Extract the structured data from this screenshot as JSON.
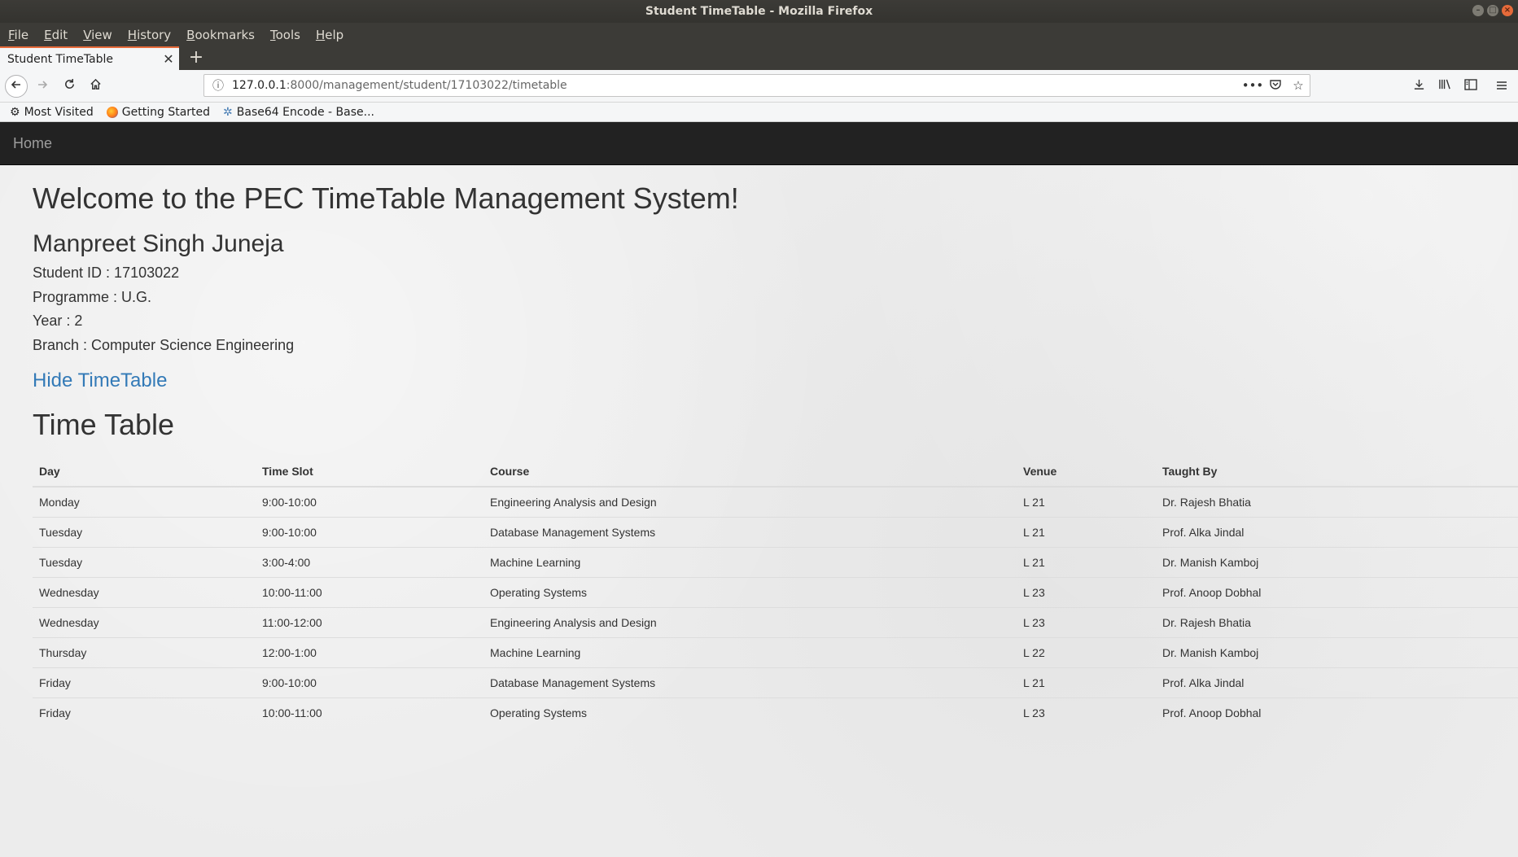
{
  "window": {
    "title": "Student TimeTable - Mozilla Firefox"
  },
  "menubar": {
    "items": [
      "File",
      "Edit",
      "View",
      "History",
      "Bookmarks",
      "Tools",
      "Help"
    ]
  },
  "tab": {
    "title": "Student TimeTable",
    "close": "✕",
    "new_tab": "+"
  },
  "url": {
    "host": "127.0.0.1",
    "path": ":8000/management/student/17103022/timetable"
  },
  "bookmarks": [
    "Most Visited",
    "Getting Started",
    "Base64 Encode - Base..."
  ],
  "site": {
    "nav_home": "Home"
  },
  "page": {
    "welcome": "Welcome to the PEC TimeTable Management System!",
    "student_name": "Manpreet Singh Juneja",
    "student_id": "Student ID : 17103022",
    "programme": "Programme : U.G.",
    "year": "Year : 2",
    "branch": "Branch : Computer Science Engineering",
    "toggle_link": "Hide TimeTable",
    "timetable_title": "Time Table"
  },
  "timetable": {
    "headers": [
      "Day",
      "Time Slot",
      "Course",
      "Venue",
      "Taught By"
    ],
    "rows": [
      [
        "Monday",
        "9:00-10:00",
        "Engineering Analysis and Design",
        "L 21",
        "Dr. Rajesh Bhatia"
      ],
      [
        "Tuesday",
        "9:00-10:00",
        "Database Management Systems",
        "L 21",
        "Prof. Alka Jindal"
      ],
      [
        "Tuesday",
        "3:00-4:00",
        "Machine Learning",
        "L 21",
        "Dr. Manish Kamboj"
      ],
      [
        "Wednesday",
        "10:00-11:00",
        "Operating Systems",
        "L 23",
        "Prof. Anoop Dobhal"
      ],
      [
        "Wednesday",
        "11:00-12:00",
        "Engineering Analysis and Design",
        "L 23",
        "Dr. Rajesh Bhatia"
      ],
      [
        "Thursday",
        "12:00-1:00",
        "Machine Learning",
        "L 22",
        "Dr. Manish Kamboj"
      ],
      [
        "Friday",
        "9:00-10:00",
        "Database Management Systems",
        "L 21",
        "Prof. Alka Jindal"
      ],
      [
        "Friday",
        "10:00-11:00",
        "Operating Systems",
        "L 23",
        "Prof. Anoop Dobhal"
      ]
    ]
  },
  "colors": {
    "accent_tab": "#e66a3a",
    "link": "#337ab7",
    "site_nav_bg": "#222222"
  }
}
